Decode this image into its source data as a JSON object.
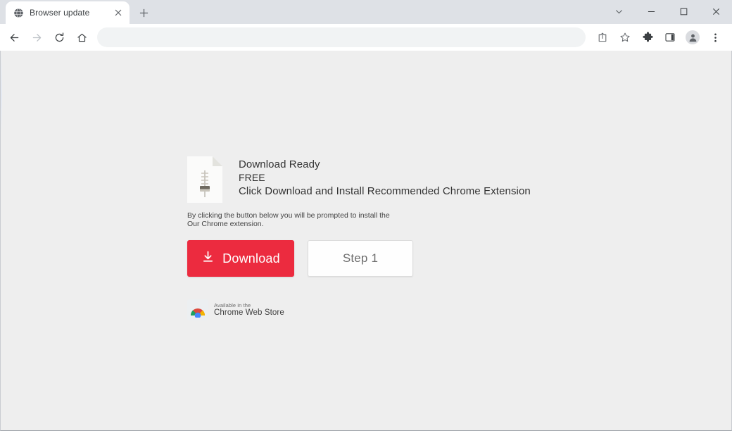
{
  "window": {
    "controls": [
      {
        "name": "tab-search-button",
        "icon": "chevron-down-icon",
        "label": ""
      },
      {
        "name": "minimize-button",
        "icon": "minimize-icon",
        "label": ""
      },
      {
        "name": "maximize-button",
        "icon": "maximize-icon",
        "label": ""
      },
      {
        "name": "close-window-button",
        "icon": "close-icon",
        "label": ""
      }
    ]
  },
  "tabs": [
    {
      "title": "Browser update",
      "favicon": "globe-icon",
      "active": true
    }
  ],
  "newtab": {
    "label": "+",
    "tooltip": "New tab"
  },
  "toolbar": {
    "back": "back-arrow-icon",
    "forward": "forward-arrow-icon",
    "reload": "reload-icon",
    "home": "home-icon",
    "omnibox_value": "",
    "omnibox_placeholder": "",
    "share": "share-icon",
    "bookmark": "star-icon",
    "extensions": "puzzle-icon",
    "side_panel": "side-panel-icon",
    "profile": "profile-avatar-icon",
    "menu": "three-dot-menu-icon"
  },
  "page": {
    "doc_icon": "document-slider-icon",
    "heading": "Download Ready",
    "price": "FREE",
    "subheading": "Click Download and Install Recommended Chrome Extension",
    "disclaimer_line1": "By clicking the button below you will be prompted to install the",
    "disclaimer_line2": "Our Chrome extension.",
    "download_button": {
      "label": "Download",
      "icon": "download-arrow-icon",
      "color": "#ec2b3f",
      "text_color": "#ffffff"
    },
    "step_button": {
      "label": "Step 1",
      "color": "#fefefe",
      "text_color": "#6d6d6d",
      "border_color": "#dcdcdc"
    },
    "webstore_badge": {
      "small_text": "Available in the",
      "big_text": "Chrome Web Store",
      "logo": "chrome-logo-icon"
    },
    "background_color": "#eeeeee"
  }
}
